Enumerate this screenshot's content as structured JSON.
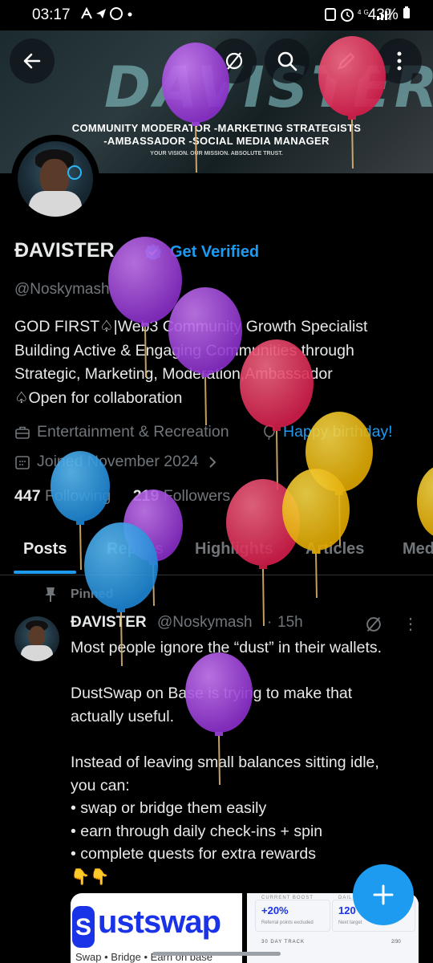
{
  "status": {
    "time": "03:17",
    "battery": "43%",
    "network": "4G"
  },
  "banner": {
    "logo_text": "DAVISTER",
    "line1": "COMMUNITY MODERATOR  -MARKETING STRATEGISTS",
    "line2": "-AMBASSADOR  -SOCIAL MEDIA MANAGER",
    "tagline": "YOUR VISION. OUR MISSION. ABSOLUTE TRUST."
  },
  "profile": {
    "name": "ĐAVISTER",
    "get_verified": "Get Verified",
    "handle": "@Noskymash",
    "bio": [
      "GOD FIRST♤|Web3 Community Growth Specialist",
      "Building Active & Engaging Communities through",
      "Strategic, Marketing, Moderation,Ambassador",
      "♤Open for collaboration"
    ],
    "category": "Entertainment & Recreation",
    "birthday": "Happy birthday!",
    "joined": "Joined November 2024",
    "following_count": "447",
    "following_label": "Following",
    "followers_count": "219",
    "followers_label": "Followers"
  },
  "tabs": [
    "Posts",
    "Replies",
    "Highlights",
    "Articles",
    "Media"
  ],
  "post": {
    "pinned_label": "Pinned",
    "author": "ĐAVISTER",
    "handle": "@Noskymash",
    "separator": "·",
    "time": "15h",
    "more": "⋮",
    "lines": [
      "Most people ignore the “dust” in their wallets.",
      "",
      "DustSwap on Base is trying to make that",
      "actually useful.",
      "",
      "Instead of leaving small balances sitting idle,",
      "you can:",
      "• swap or bridge them easily",
      "• earn through daily check-ins + spin",
      "• complete quests for extra rewards",
      "👇👇"
    ],
    "media1": {
      "logo_letter": "S",
      "logo_text": "ustswap",
      "subtitle": "Swap • Bridge • Earn on base"
    },
    "media2": {
      "label1": "CURRENT BOOST",
      "value1": "+20%",
      "sub1": "Referral points excluded",
      "label2": "DAIL",
      "value2": "120",
      "sub2": "Next target",
      "label3": "30 DAY TRACK",
      "label4": "2/30"
    }
  },
  "fab_label": "+",
  "icons": [
    "back-arrow-icon",
    "grok-icon",
    "search-icon",
    "edit-icon",
    "more-icon",
    "briefcase-icon",
    "balloon-icon",
    "calendar-icon",
    "pin-icon",
    "compose-icon"
  ],
  "colors": {
    "accent": "#1d9bf0",
    "background": "#000000",
    "text": "#e7e9ea",
    "muted": "#71767b",
    "balloon_purple": "#a64ce0",
    "balloon_red": "#e8385f",
    "balloon_yellow": "#f3c316",
    "balloon_blue": "#2d9de6"
  }
}
